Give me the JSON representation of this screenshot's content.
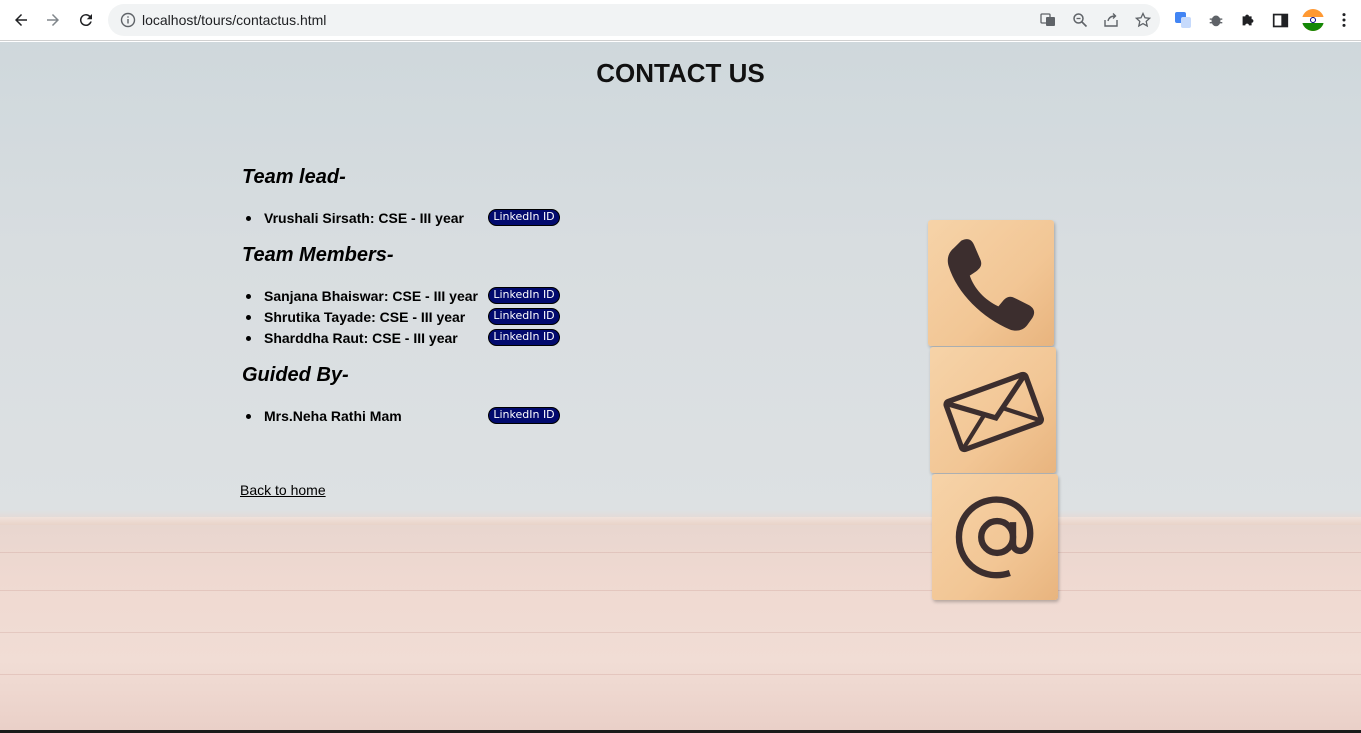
{
  "browser": {
    "url": "localhost/tours/contactus.html",
    "icons": [
      "back-icon",
      "forward-icon",
      "reload-icon",
      "info-icon",
      "translate-icon",
      "zoom-icon",
      "share-icon",
      "star-icon",
      "extension-translate-icon",
      "bug-icon",
      "puzzle-icon",
      "sidepanel-icon",
      "profile-avatar",
      "menu-icon"
    ]
  },
  "page": {
    "title": "CONTACT US",
    "sections": [
      {
        "heading": "Team lead-",
        "people": [
          {
            "name": "Vrushali Sirsath: CSE - III year",
            "badge": "LinkedIn ID"
          }
        ]
      },
      {
        "heading": "Team Members-",
        "people": [
          {
            "name": "Sanjana Bhaiswar: CSE - III year",
            "badge": "LinkedIn ID"
          },
          {
            "name": "Shrutika Tayade: CSE - III year",
            "badge": "LinkedIn ID"
          },
          {
            "name": "Sharddha Raut: CSE - III year",
            "badge": "LinkedIn ID"
          }
        ]
      },
      {
        "heading": "Guided By-",
        "people": [
          {
            "name": "Mrs.Neha Rathi Mam",
            "badge": "LinkedIn ID"
          }
        ]
      }
    ],
    "back_link": "Back to home",
    "block_icons": [
      "phone-icon",
      "envelope-icon",
      "at-sign-icon"
    ]
  },
  "colors": {
    "badge_bg": "#020a6e",
    "text": "#000000"
  }
}
